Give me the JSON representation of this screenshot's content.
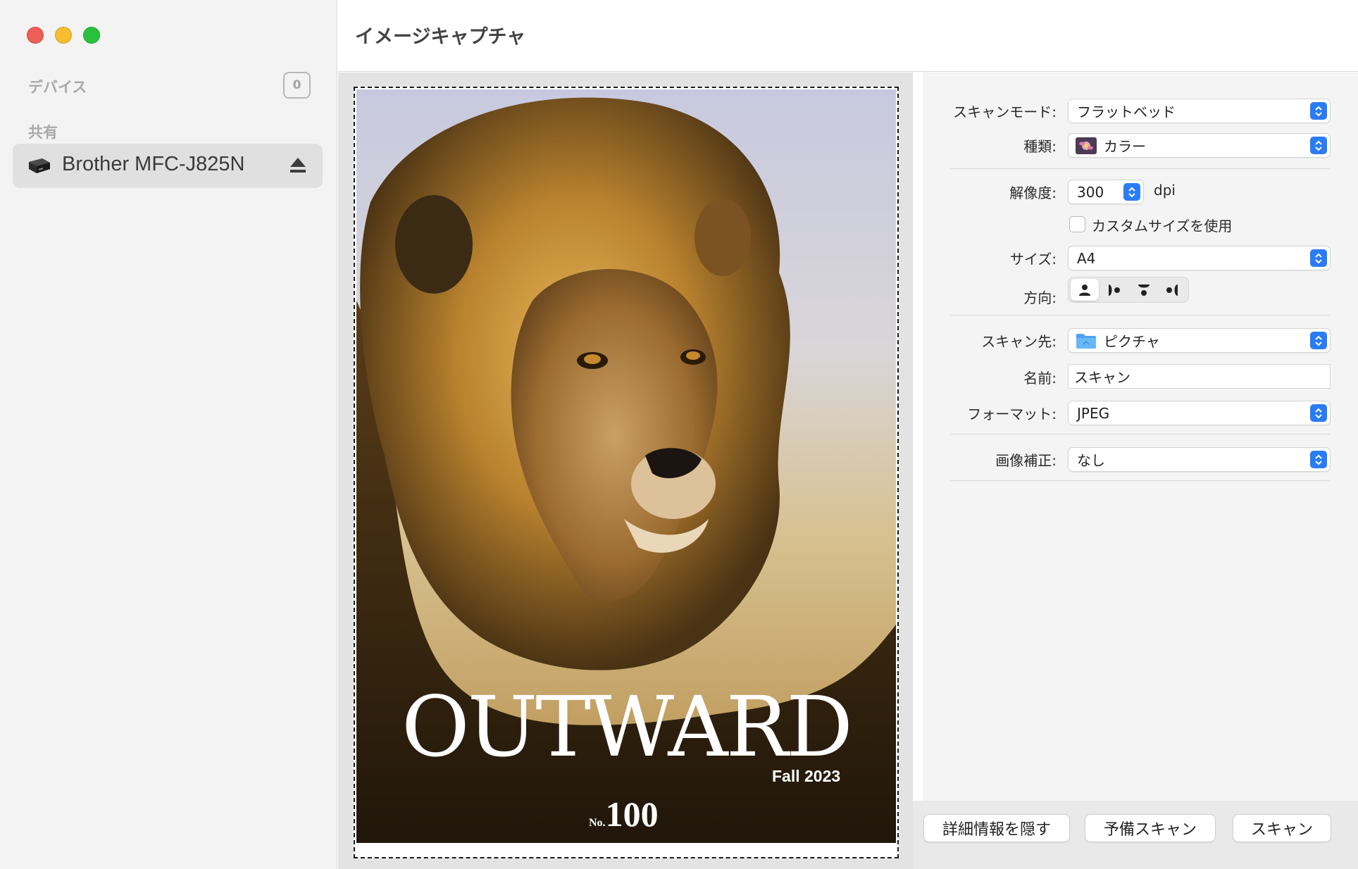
{
  "window": {
    "title": "イメージキャプチャ"
  },
  "sidebar": {
    "devices_label": "デバイス",
    "devices_count": "0",
    "shared_label": "共有",
    "shared_devices": [
      {
        "name": "Brother MFC-J825N",
        "icon": "printer-icon",
        "action_icon": "eject-icon"
      }
    ]
  },
  "preview": {
    "magazine_title": "OUTWARD",
    "season": "Fall 2023",
    "issue_prefix": "No.",
    "issue_number": "100"
  },
  "settings": {
    "scan_mode": {
      "label": "スキャンモード:",
      "value": "フラットベッド"
    },
    "kind": {
      "label": "種類:",
      "value": "カラー",
      "icon": "color-photo-icon"
    },
    "resolution": {
      "label": "解像度:",
      "value": "300",
      "unit": "dpi"
    },
    "custom_size": {
      "label": "カスタムサイズを使用",
      "checked": false
    },
    "size": {
      "label": "サイズ:",
      "value": "A4"
    },
    "orientation": {
      "label": "方向:",
      "selected_index": 0,
      "options": [
        "portrait-icon",
        "rotate-right-icon",
        "upside-down-icon",
        "rotate-left-icon"
      ]
    },
    "destination": {
      "label": "スキャン先:",
      "value": "ピクチャ",
      "icon": "folder-icon"
    },
    "name": {
      "label": "名前:",
      "value": "スキャン"
    },
    "format": {
      "label": "フォーマット:",
      "value": "JPEG"
    },
    "correction": {
      "label": "画像補正:",
      "value": "なし"
    }
  },
  "footer": {
    "hide_details": "詳細情報を隠す",
    "overview": "予備スキャン",
    "scan": "スキャン"
  },
  "colors": {
    "accent": "#2a7cf4",
    "close": "#ee5f57",
    "minimize": "#f5bd2f",
    "zoom": "#29c13d"
  }
}
